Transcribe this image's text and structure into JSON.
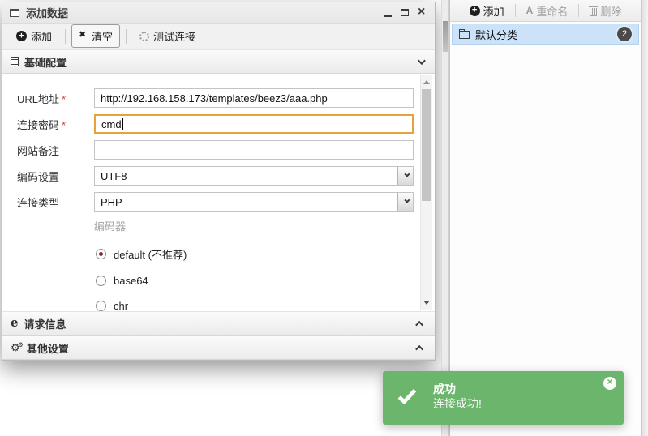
{
  "dialog": {
    "title": "添加数据",
    "toolbar": {
      "add_label": "添加",
      "clear_label": "清空",
      "test_label": "测试连接"
    },
    "sections": {
      "basic_label": "基础配置",
      "request_label": "请求信息",
      "other_label": "其他设置"
    },
    "form": {
      "required_marker": "*",
      "url_label": "URL地址",
      "url_value": "http://192.168.158.173/templates/beez3/aaa.php",
      "password_label": "连接密码",
      "password_value": "cmd",
      "note_label": "网站备注",
      "note_value": "",
      "encoding_label": "编码设置",
      "encoding_value": "UTF8",
      "type_label": "连接类型",
      "type_value": "PHP",
      "encoder_group_label": "编码器",
      "encoders": [
        {
          "label": "default (不推荐)",
          "selected": true
        },
        {
          "label": "base64",
          "selected": false
        },
        {
          "label": "chr",
          "selected": false
        }
      ]
    }
  },
  "category_panel": {
    "toolbar": {
      "add_label": "添加",
      "rename_label": "重命名",
      "delete_label": "删除"
    },
    "items": [
      {
        "label": "默认分类",
        "count": "2",
        "selected": true
      }
    ]
  },
  "toast": {
    "title": "成功",
    "message": "连接成功!"
  },
  "colors": {
    "toast_green": "#6cb56d",
    "focus_orange": "#e6a33c",
    "selection_blue": "#cbe2f9",
    "required_red": "#d43f3a"
  }
}
